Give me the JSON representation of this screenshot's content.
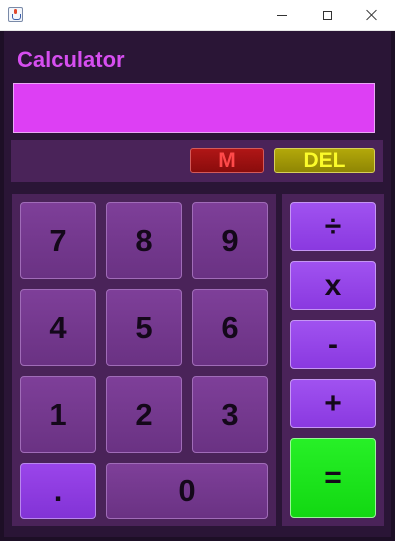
{
  "window": {
    "icon": "java-cup-icon",
    "controls": {
      "minimize": "minimize-icon",
      "maximize": "maximize-icon",
      "close": "close-icon"
    }
  },
  "app": {
    "title": "Calculator",
    "display_value": ""
  },
  "memory": {
    "m_label": "M",
    "del_label": "DEL"
  },
  "keypad": {
    "keys": [
      "7",
      "8",
      "9",
      "4",
      "5",
      "6",
      "1",
      "2",
      "3",
      ".",
      "0"
    ]
  },
  "operators": {
    "divide": "÷",
    "multiply": "x",
    "subtract": "-",
    "add": "+",
    "equals": "="
  },
  "colors": {
    "background": "#2a1536",
    "panel": "#4a2359",
    "title": "#d64ef0",
    "display": "#dd3ff4",
    "memory_button": "#a01212",
    "memory_text": "#ff4a4a",
    "delete_button": "#a59a08",
    "delete_text": "#fbfb2a",
    "number_key": "#743a8e",
    "operator_key": "#9546e8",
    "equals_key": "#1ee41e"
  }
}
